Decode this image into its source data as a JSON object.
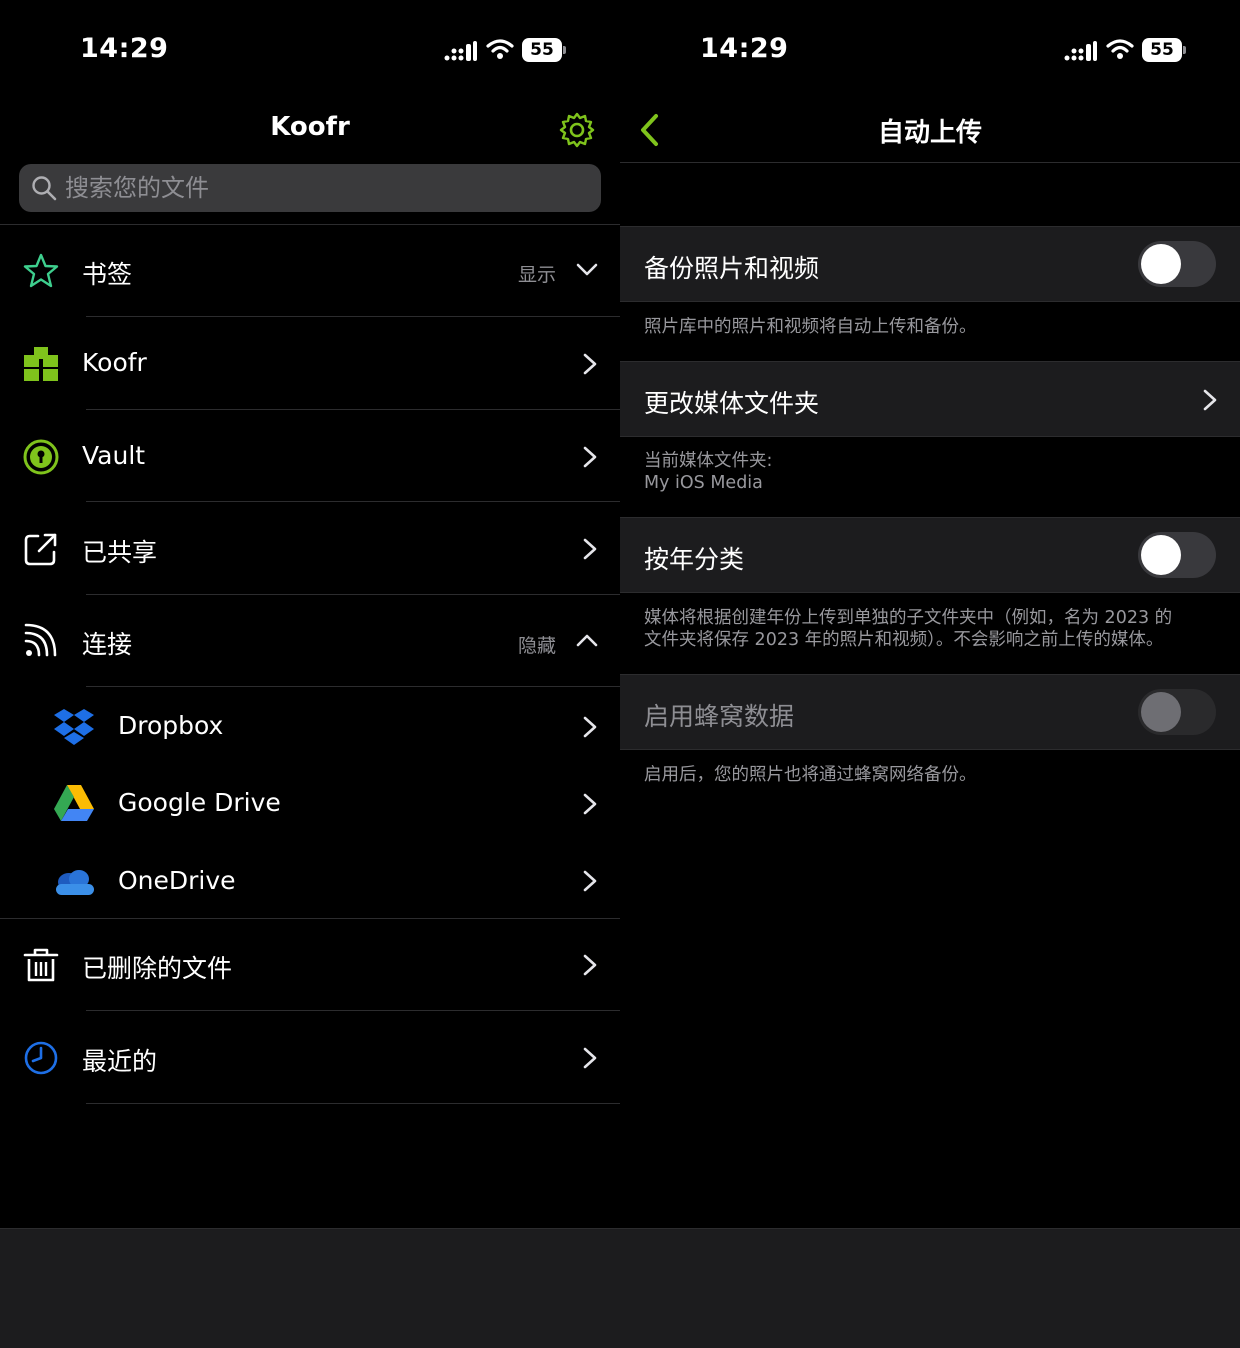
{
  "left": {
    "status": {
      "time": "14:29",
      "battery": "55"
    },
    "title": "Koofr",
    "search": {
      "placeholder": "搜索您的文件"
    },
    "items": [
      {
        "label": "书签",
        "aux": "显示"
      },
      {
        "label": "Koofr"
      },
      {
        "label": "Vault"
      },
      {
        "label": "已共享"
      },
      {
        "label": "连接",
        "aux": "隐藏"
      },
      {
        "label": "Dropbox"
      },
      {
        "label": "Google Drive"
      },
      {
        "label": "OneDrive"
      },
      {
        "label": "已删除的文件"
      },
      {
        "label": "最近的"
      }
    ]
  },
  "right": {
    "status": {
      "time": "14:29",
      "battery": "55"
    },
    "title": "自动上传",
    "backup": {
      "label": "备份照片和视频",
      "on": false,
      "note": "照片库中的照片和视频将自动上传和备份。"
    },
    "media_folder": {
      "label": "更改媒体文件夹",
      "note_title": "当前媒体文件夹:",
      "note_value": "My iOS Media"
    },
    "by_year": {
      "label": "按年分类",
      "on": false,
      "note_line1": "媒体将根据创建年份上传到单独的子文件夹中（例如，名为 2023 的",
      "note_line2": "文件夹将保存 2023 年的照片和视频）。不会影响之前上传的媒体。"
    },
    "cellular": {
      "label": "启用蜂窝数据",
      "on": false,
      "enabled": false,
      "note": "启用后，您的照片也将通过蜂窝网络备份。"
    }
  },
  "colors": {
    "accent": "#7fc31c",
    "link_blue": "#1e6fe6",
    "text_secondary": "#8e8e93"
  }
}
